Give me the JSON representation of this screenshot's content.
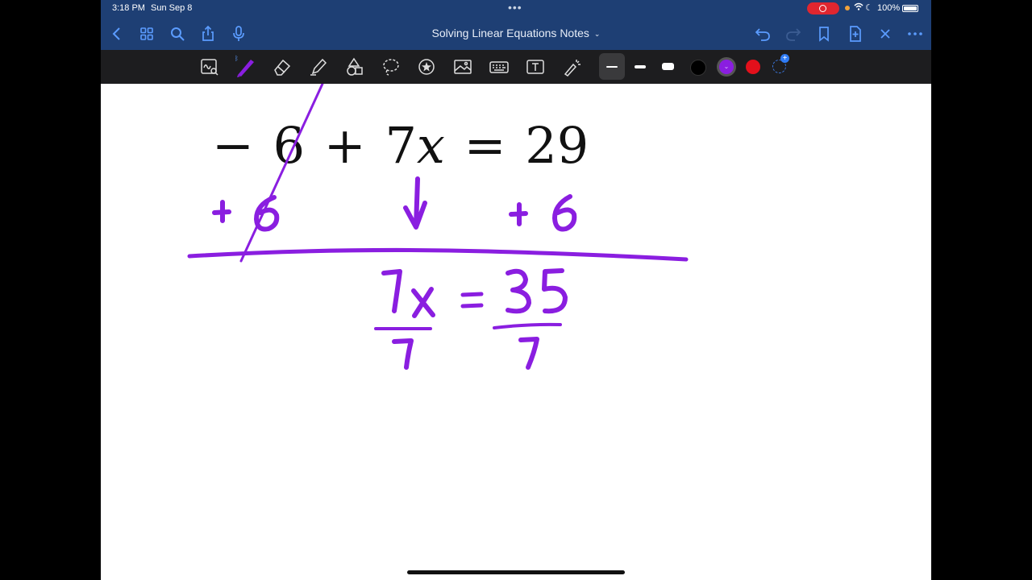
{
  "status_bar": {
    "time": "3:18 PM",
    "date": "Sun Sep 8",
    "battery": "100%"
  },
  "nav": {
    "title": "Solving Linear Equations Notes",
    "icons": [
      "back-icon",
      "thumbnails-icon",
      "search-icon",
      "share-icon",
      "microphone-icon",
      "undo-icon",
      "redo-icon",
      "bookmark-icon",
      "add-page-icon",
      "close-icon",
      "more-icon"
    ]
  },
  "toolbar": {
    "tools": [
      "handwriting-to-text-icon",
      "pen-icon",
      "eraser-icon",
      "highlighter-icon",
      "shapes-icon",
      "lasso-icon",
      "sticker-icon",
      "image-icon",
      "keyboard-icon",
      "text-box-icon",
      "laser-pointer-icon"
    ],
    "stroke_widths": [
      "thin",
      "medium",
      "thick"
    ],
    "colors": [
      "#000000",
      "#8a1ee0",
      "#e3101b"
    ],
    "selected_color": "#8a1ee0"
  },
  "page": {
    "equation": "− 6 + 7x = 29",
    "handwriting": {
      "ink_color": "#8a1ee0",
      "lines": [
        "+6",
        "↓",
        "+6",
        "7x = 35",
        "7 / 7"
      ]
    }
  }
}
